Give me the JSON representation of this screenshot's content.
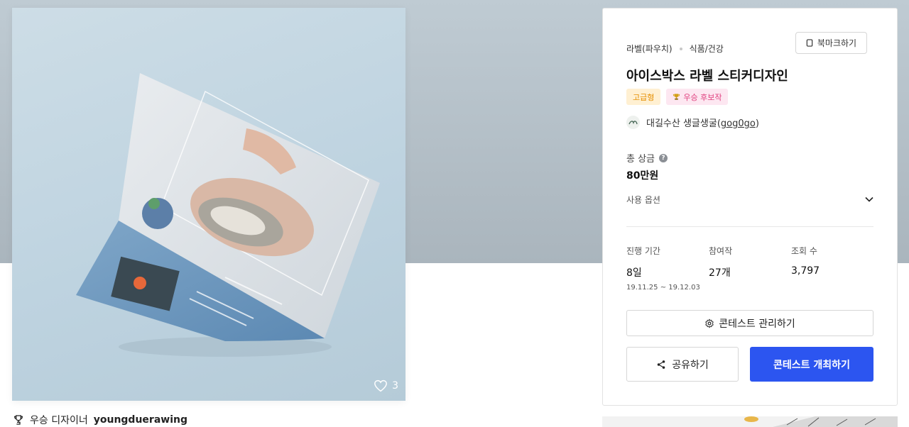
{
  "image": {
    "likes": "3"
  },
  "winner": {
    "label": "우승 디자이너",
    "name": "youngduerawing"
  },
  "panel": {
    "categories": [
      "라벨(파우치)",
      "식품/건강"
    ],
    "bookmark_label": "북마크하기",
    "title": "아이스박스 라벨 스티커디자인",
    "badges": {
      "premium": "고급형",
      "candidate": "우승 후보작"
    },
    "host": {
      "name": "대길수산 생글생굴",
      "handle": "gog0go"
    },
    "prize": {
      "label": "총 상금",
      "value": "80만원"
    },
    "options_label": "사용 옵션",
    "stats": {
      "period": {
        "label": "진행 기간",
        "value": "8일",
        "range_start": "19.11.25",
        "range_end": "19.12.03"
      },
      "entries": {
        "label": "참여작",
        "value": "27개"
      },
      "views": {
        "label": "조회 수",
        "value": "3,797"
      }
    },
    "manage_label": "콘테스트 관리하기",
    "share_label": "공유하기",
    "host_contest_label": "콘테스트 개최하기"
  },
  "colors": {
    "primary": "#2c55f0",
    "premium_badge_bg": "#fff0d2",
    "premium_badge_text": "#e58e00",
    "candidate_badge_bg": "#fde7f1",
    "candidate_badge_text": "#e0407f",
    "hero_bg": "#b5c1c9"
  }
}
